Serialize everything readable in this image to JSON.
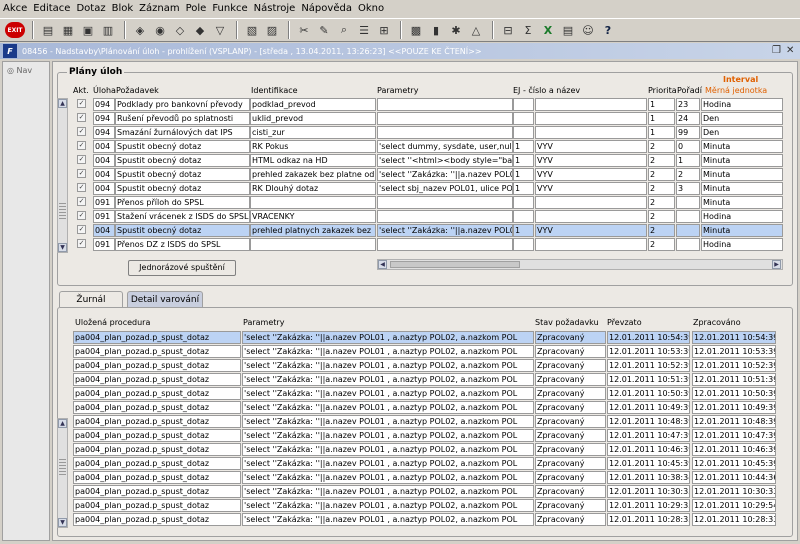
{
  "menu": [
    "Akce",
    "Editace",
    "Dotaz",
    "Blok",
    "Záznam",
    "Pole",
    "Funkce",
    "Nástroje",
    "Nápověda",
    "Okno"
  ],
  "window_title": "08456 - Nadstavby\\Plánování úloh - prohlížení (VSPLANP) - [středa , 13.04.2011, 13:26:23] <<POUZE KE ČTENÍ>>",
  "nav_label": "Nav",
  "plans": {
    "title": "Plány úloh",
    "headers": {
      "akt": "Akt.",
      "uloha": "Úloha",
      "pozadavek": "Požadavek",
      "identifikace": "Identifikace",
      "parametry": "Parametry",
      "ej": "EJ - číslo a název",
      "priorita": "Priorita",
      "poradi": "Pořadí",
      "interval": "Interval",
      "merna": "Měrná jednotka"
    },
    "rows": [
      {
        "uloha": "094",
        "pozadavek": "Podklady pro bankovní převody",
        "identifikace": "podklad_prevod",
        "parametry": "",
        "ej_cislo": "",
        "ej_nazev": "",
        "priorita": "1",
        "poradi": "23",
        "jednotka": "Hodina"
      },
      {
        "uloha": "094",
        "pozadavek": "Rušení převodů po splatnosti",
        "identifikace": "uklid_prevod",
        "parametry": "",
        "ej_cislo": "",
        "ej_nazev": "",
        "priorita": "1",
        "poradi": "24",
        "jednotka": "Den"
      },
      {
        "uloha": "094",
        "pozadavek": "Smazání žurnálových dat IPS",
        "identifikace": "cisti_zur",
        "parametry": "",
        "ej_cislo": "",
        "ej_nazev": "",
        "priorita": "1",
        "poradi": "99",
        "jednotka": "Den"
      },
      {
        "uloha": "004",
        "pozadavek": "Spustit obecný dotaz",
        "identifikace": "RK Pokus",
        "parametry": "'select dummy, sysdate, user,null,",
        "ej_cislo": "1",
        "ej_nazev": "VYV",
        "priorita": "2",
        "poradi": "0",
        "jednotka": "Minuta"
      },
      {
        "uloha": "004",
        "pozadavek": "Spustit obecný dotaz",
        "identifikace": "HTML odkaz na HD",
        "parametry": "'select ''<html><body style=\"backgr",
        "ej_cislo": "1",
        "ej_nazev": "VYV",
        "priorita": "2",
        "poradi": "1",
        "jednotka": "Minuta"
      },
      {
        "uloha": "004",
        "pozadavek": "Spustit obecný dotaz",
        "identifikace": "prehled zakazek bez platne od",
        "parametry": "'select ''Zakázka: ''||a.nazev POL01",
        "ej_cislo": "1",
        "ej_nazev": "VYV",
        "priorita": "2",
        "poradi": "2",
        "jednotka": "Minuta"
      },
      {
        "uloha": "004",
        "pozadavek": "Spustit obecný dotaz",
        "identifikace": "RK Dlouhý dotaz",
        "parametry": "'select sbj_nazev POL01, ulice POL",
        "ej_cislo": "1",
        "ej_nazev": "VYV",
        "priorita": "2",
        "poradi": "3",
        "jednotka": "Minuta"
      },
      {
        "uloha": "091",
        "pozadavek": "Přenos příloh do SPSL",
        "identifikace": "",
        "parametry": "",
        "ej_cislo": "",
        "ej_nazev": "",
        "priorita": "2",
        "poradi": "",
        "jednotka": "Minuta"
      },
      {
        "uloha": "091",
        "pozadavek": "Stažení vrácenek z ISDS do SPSL",
        "identifikace": "VRACENKY",
        "parametry": "",
        "ej_cislo": "",
        "ej_nazev": "",
        "priorita": "2",
        "poradi": "",
        "jednotka": "Hodina"
      },
      {
        "uloha": "004",
        "pozadavek": "Spustit obecný dotaz",
        "identifikace": "prehled platnych zakazek bez",
        "parametry": "'select ''Zakázka: ''||a.nazev POL01",
        "ej_cislo": "1",
        "ej_nazev": "VYV",
        "priorita": "2",
        "poradi": "",
        "jednotka": "Minuta"
      },
      {
        "uloha": "091",
        "pozadavek": "Přenos DZ z ISDS do SPSL",
        "identifikace": "",
        "parametry": "",
        "ej_cislo": "",
        "ej_nazev": "",
        "priorita": "2",
        "poradi": "",
        "jednotka": "Hodina"
      }
    ],
    "run_once_label": "Jednorázové spuštění"
  },
  "tabs": [
    "Žurnál",
    "Detail varování"
  ],
  "journal": {
    "headers": {
      "procedura": "Uložená procedura",
      "parametry": "Parametry",
      "stav": "Stav požadavku",
      "prevzato": "Převzato",
      "zpracovano": "Zpracováno"
    },
    "param_text": "'select ''Zakázka: ''||a.nazev POL01 ,          a.naztyp POL02,          a.nazkom POL",
    "rows": [
      {
        "proc": "pa004_plan_pozad.p_spust_dotaz",
        "stav": "Zpracovaný",
        "prevzato": "12.01.2011 10:54:39",
        "zpracovano": "12.01.2011 10:54:39"
      },
      {
        "proc": "pa004_plan_pozad.p_spust_dotaz",
        "stav": "Zpracovaný",
        "prevzato": "12.01.2011 10:53:39",
        "zpracovano": "12.01.2011 10:53:39"
      },
      {
        "proc": "pa004_plan_pozad.p_spust_dotaz",
        "stav": "Zpracovaný",
        "prevzato": "12.01.2011 10:52:39",
        "zpracovano": "12.01.2011 10:52:39"
      },
      {
        "proc": "pa004_plan_pozad.p_spust_dotaz",
        "stav": "Zpracovaný",
        "prevzato": "12.01.2011 10:51:39",
        "zpracovano": "12.01.2011 10:51:39"
      },
      {
        "proc": "pa004_plan_pozad.p_spust_dotaz",
        "stav": "Zpracovaný",
        "prevzato": "12.01.2011 10:50:39",
        "zpracovano": "12.01.2011 10:50:39"
      },
      {
        "proc": "pa004_plan_pozad.p_spust_dotaz",
        "stav": "Zpracovaný",
        "prevzato": "12.01.2011 10:49:39",
        "zpracovano": "12.01.2011 10:49:39"
      },
      {
        "proc": "pa004_plan_pozad.p_spust_dotaz",
        "stav": "Zpracovaný",
        "prevzato": "12.01.2011 10:48:39",
        "zpracovano": "12.01.2011 10:48:39"
      },
      {
        "proc": "pa004_plan_pozad.p_spust_dotaz",
        "stav": "Zpracovaný",
        "prevzato": "12.01.2011 10:47:39",
        "zpracovano": "12.01.2011 10:47:39"
      },
      {
        "proc": "pa004_plan_pozad.p_spust_dotaz",
        "stav": "Zpracovaný",
        "prevzato": "12.01.2011 10:46:39",
        "zpracovano": "12.01.2011 10:46:39"
      },
      {
        "proc": "pa004_plan_pozad.p_spust_dotaz",
        "stav": "Zpracovaný",
        "prevzato": "12.01.2011 10:45:39",
        "zpracovano": "12.01.2011 10:45:39"
      },
      {
        "proc": "pa004_plan_pozad.p_spust_dotaz",
        "stav": "Zpracovaný",
        "prevzato": "12.01.2011 10:38:34",
        "zpracovano": "12.01.2011 10:44:36"
      },
      {
        "proc": "pa004_plan_pozad.p_spust_dotaz",
        "stav": "Zpracovaný",
        "prevzato": "12.01.2011 10:30:33",
        "zpracovano": "12.01.2011 10:30:33"
      },
      {
        "proc": "pa004_plan_pozad.p_spust_dotaz",
        "stav": "Zpracovaný",
        "prevzato": "12.01.2011 10:29:33",
        "zpracovano": "12.01.2011 10:29:54"
      },
      {
        "proc": "pa004_plan_pozad.p_spust_dotaz",
        "stav": "Zpracovaný",
        "prevzato": "12.01.2011 10:28:33",
        "zpracovano": "12.01.2011 10:28:33"
      }
    ]
  }
}
